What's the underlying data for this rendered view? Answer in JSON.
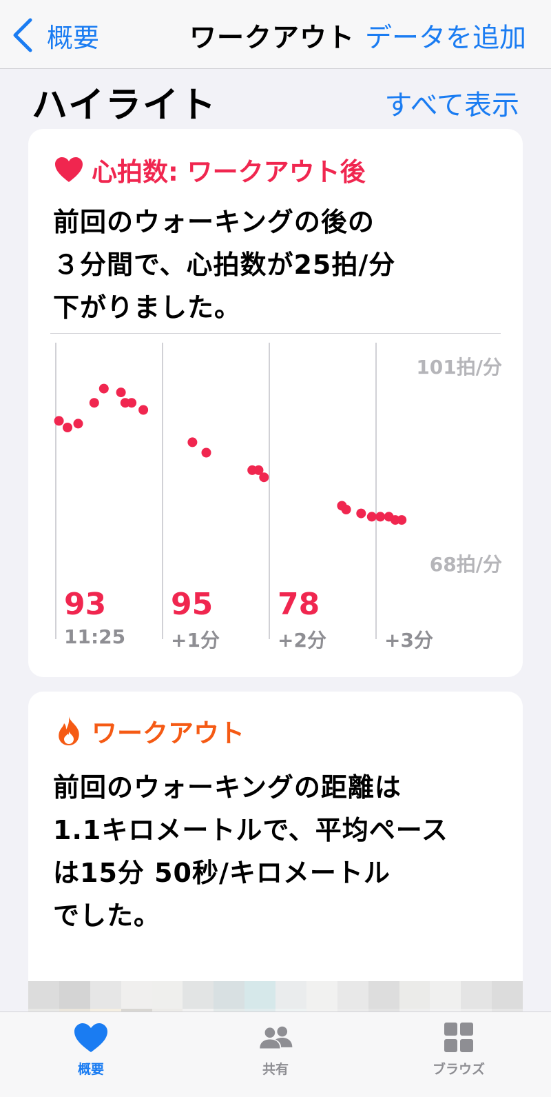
{
  "nav": {
    "back_label": "概要",
    "title": "ワークアウト",
    "add_label": "データを追加"
  },
  "section": {
    "title": "ハイライト",
    "see_all": "すべて表示"
  },
  "heart_card": {
    "icon": "heart-icon",
    "title": "心拍数: ワークアウト後",
    "body_lines": [
      "前回のウォーキングの後の",
      "３分間で、心拍数が25拍/分",
      "下がりました。"
    ],
    "accent_color": "#f0264f"
  },
  "chart_data": {
    "type": "scatter",
    "y_max_label": "101拍/分",
    "y_min_label": "68拍/分",
    "ylim": [
      68,
      101
    ],
    "xlim": [
      0,
      4
    ],
    "columns": [
      {
        "value": "93",
        "time": "11:25"
      },
      {
        "value": "95",
        "time": "+1分"
      },
      {
        "value": "78",
        "time": "+2分"
      },
      {
        "value": "",
        "time": "+3分"
      }
    ],
    "points": [
      {
        "x": 0.03,
        "y": 91.5
      },
      {
        "x": 0.11,
        "y": 90.3
      },
      {
        "x": 0.21,
        "y": 91.0
      },
      {
        "x": 0.36,
        "y": 94.8
      },
      {
        "x": 0.45,
        "y": 97.4
      },
      {
        "x": 0.61,
        "y": 96.7
      },
      {
        "x": 0.65,
        "y": 94.8
      },
      {
        "x": 0.71,
        "y": 94.8
      },
      {
        "x": 0.82,
        "y": 93.5
      },
      {
        "x": 1.28,
        "y": 87.6
      },
      {
        "x": 1.41,
        "y": 85.7
      },
      {
        "x": 1.84,
        "y": 82.5
      },
      {
        "x": 1.9,
        "y": 82.5
      },
      {
        "x": 1.95,
        "y": 81.2
      },
      {
        "x": 2.68,
        "y": 76.0
      },
      {
        "x": 2.72,
        "y": 75.3
      },
      {
        "x": 2.86,
        "y": 74.6
      },
      {
        "x": 2.96,
        "y": 74.0
      },
      {
        "x": 3.04,
        "y": 74.0
      },
      {
        "x": 3.12,
        "y": 74.0
      },
      {
        "x": 3.18,
        "y": 73.4
      },
      {
        "x": 3.24,
        "y": 73.4
      }
    ],
    "point_color": "#f0264f"
  },
  "workout_card": {
    "icon": "flame-icon",
    "title": "ワークアウト",
    "body_lines": [
      "前回のウォーキングの距離は",
      "1.1キロメートルで、平均ペース",
      "は15分 50秒/キロメートル",
      "でした。"
    ],
    "accent_color": "#f55a14"
  },
  "tabbar": {
    "tabs": [
      {
        "label": "概要",
        "icon": "heart-icon",
        "active": true
      },
      {
        "label": "共有",
        "icon": "people-icon",
        "active": false
      },
      {
        "label": "ブラウズ",
        "icon": "grid-icon",
        "active": false
      }
    ]
  }
}
